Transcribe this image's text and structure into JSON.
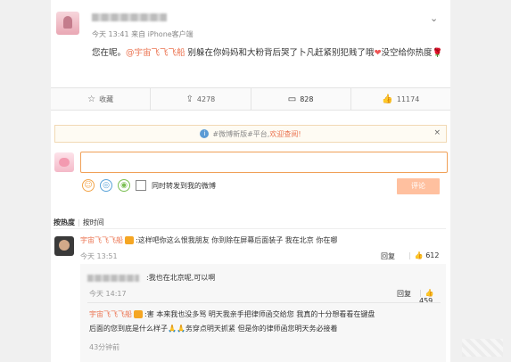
{
  "post": {
    "meta": "今天 13:41 来自 iPhone客户端",
    "text_before": "您在呢。",
    "mention": "@宇宙飞飞飞船",
    "text_after": " 别躲在你妈妈和大粉背后哭了卜凡赶紧别犯贱了哦",
    "text_tail": "没空给你热度",
    "heart_icon": "heart-icon",
    "rose_icon": "rose-icon"
  },
  "actions": {
    "favorite": "收藏",
    "repost": "4278",
    "comment": "828",
    "like": "11174"
  },
  "notice": {
    "text": "#微博新版#平台,",
    "link": "欢迎查阅!",
    "close": "×"
  },
  "composer": {
    "input_value": "",
    "sync_label": "同时转发到我的微博",
    "submit_label": "评论"
  },
  "sort": {
    "hot": "按热度",
    "time": "按时间"
  },
  "comment": {
    "user": "宇宙飞飞飞船",
    "text": ":这样吧你这么恨我朋友 你到除在屏幕后面装子 我在北京 你在哪",
    "time": "今天 13:51",
    "reply_label": "回复",
    "likes": "612"
  },
  "reply1": {
    "text": ":我也在北京呢,可以啊",
    "time": "今天 14:17",
    "reply_label": "回复",
    "likes": "459"
  },
  "reply2": {
    "user": "宇宙飞飞飞船",
    "text1": ":害 本来我也没多骂 明天我亲手把律师函交给您 我真的十分想看看在键盘",
    "text2": "后面的您到底是什么样子",
    "text3": "务穿点明天抓紧 但是你的律师函您明天务必接着",
    "time": "43分钟前"
  }
}
